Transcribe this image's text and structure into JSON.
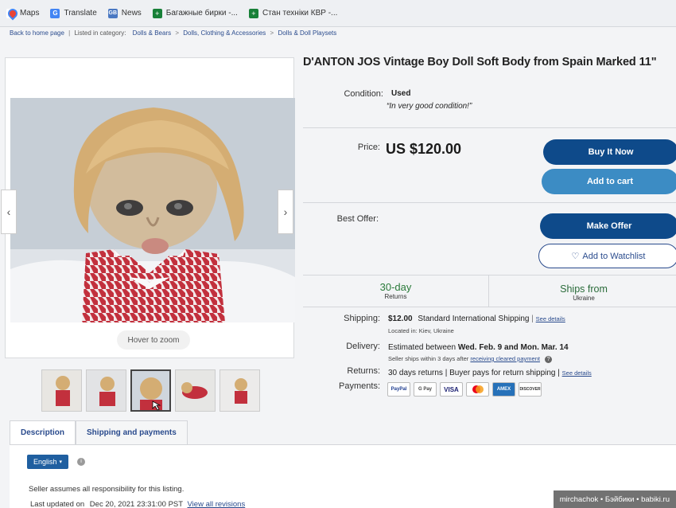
{
  "bookmarks": [
    {
      "label": "Maps",
      "icon": "maps-icon"
    },
    {
      "label": "Translate",
      "icon": "translate-icon"
    },
    {
      "label": "News",
      "icon": "news-icon"
    },
    {
      "label": "Багажные бирки -...",
      "icon": "sheets-icon"
    },
    {
      "label": "Стан техніки КВР -...",
      "icon": "sheets-icon"
    }
  ],
  "breadcrumb": {
    "back": "Back to home page",
    "listed_in": "Listed in category:",
    "cat1": "Dolls & Bears",
    "cat2": "Dolls, Clothing & Accessories",
    "cat3": "Dolls & Doll Playsets"
  },
  "gallery": {
    "hover_zoom": "Hover to zoom",
    "prev_arrow": "‹",
    "next_arrow": "›"
  },
  "item": {
    "title": "D'ANTON JOS Vintage Boy Doll Soft Body from Spain Marked 11\"",
    "condition_label": "Condition:",
    "condition_value": "Used",
    "condition_note": "In very good condition!",
    "price_label": "Price:",
    "price": "US $120.00",
    "best_offer_label": "Best Offer:"
  },
  "buttons": {
    "buy_now": "Buy It Now",
    "add_to_cart": "Add to cart",
    "make_offer": "Make Offer",
    "watchlist": "Add to Watchlist"
  },
  "badges": {
    "returns_days": "30-day",
    "returns_label": "Returns",
    "ships_from_label": "Ships from",
    "ships_from_value": "Ukraine"
  },
  "shipping": {
    "label": "Shipping:",
    "cost": "$12.00",
    "method": "Standard International Shipping",
    "see_details": "See details",
    "located": "Located in: Kiev, Ukraine"
  },
  "delivery": {
    "label": "Delivery:",
    "prefix": "Estimated between",
    "range": "Wed. Feb. 9 and Mon. Mar. 14",
    "note": "Seller ships within 3 days after",
    "note_link": "receiving cleared payment"
  },
  "returns": {
    "label": "Returns:",
    "text": "30 days returns | Buyer pays for return shipping |",
    "see_details": "See details"
  },
  "payments": {
    "label": "Payments:",
    "methods": [
      "PayPal",
      "G Pay",
      "VISA",
      "MC",
      "AMEX",
      "DISCOVER"
    ]
  },
  "tabs": {
    "description": "Description",
    "shipping": "Shipping and payments"
  },
  "description": {
    "language": "English",
    "responsibility": "Seller assumes all responsibility for this listing.",
    "last_updated_label": "Last updated on",
    "last_updated_value": "Dec 20, 2021 23:31:00 PST",
    "view_revisions": "View all revisions"
  },
  "watermark": "mirchachok • Бэйбики • babiki.ru",
  "colors": {
    "primary_button": "#0e4a8a",
    "secondary_button": "#3c8cc4",
    "link": "#2a4b8d",
    "returns_green": "#2a7a3a"
  }
}
